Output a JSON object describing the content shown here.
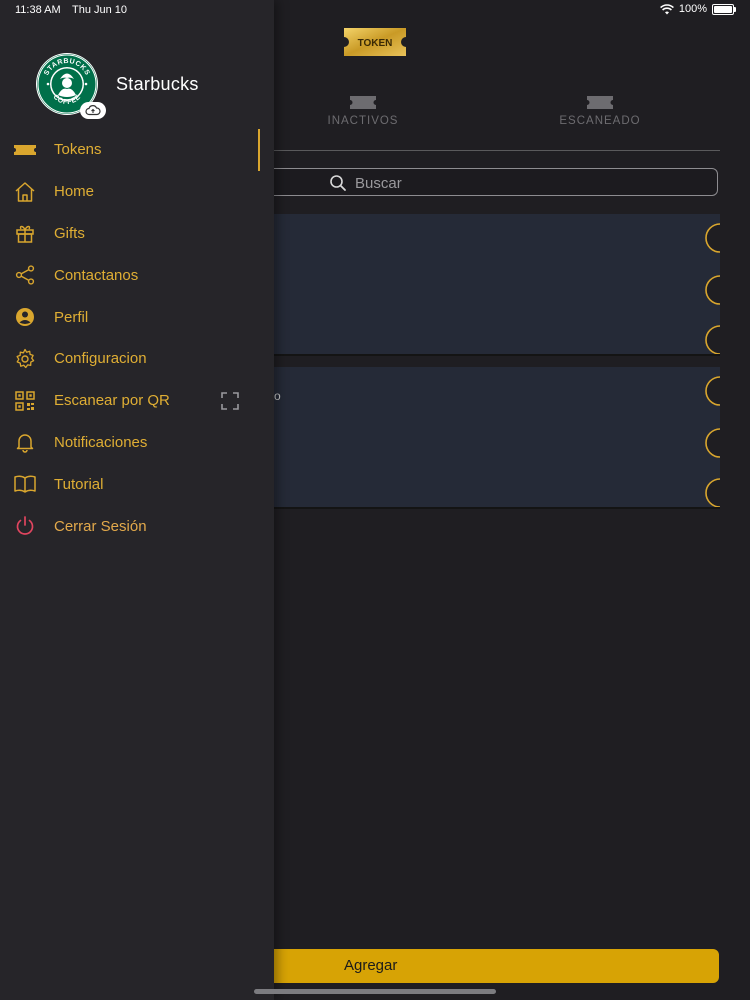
{
  "status_bar": {
    "time": "11:38 AM",
    "date": "Thu Jun 10",
    "battery": "100%"
  },
  "header": {
    "logo_text": "TOKEN"
  },
  "tabs": [
    {
      "label": "INACTIVOS"
    },
    {
      "label": "ESCANEADO"
    }
  ],
  "search": {
    "placeholder": "Buscar"
  },
  "cards": [
    {
      "fragment": ""
    },
    {
      "fragment": "o"
    }
  ],
  "add_button": {
    "label": "Agregar"
  },
  "drawer": {
    "brand_name": "Starbucks",
    "logo_text": "STARBUCKS COFFEE",
    "menu": [
      {
        "label": "Tokens",
        "icon": "ticket-icon"
      },
      {
        "label": "Home",
        "icon": "home-icon"
      },
      {
        "label": "Gifts",
        "icon": "gift-icon"
      },
      {
        "label": "Contactanos",
        "icon": "share-icon"
      },
      {
        "label": "Perfil",
        "icon": "user-circle-icon"
      },
      {
        "label": "Configuracion",
        "icon": "gear-icon"
      },
      {
        "label": "Escanear por QR",
        "icon": "qr-code-icon"
      },
      {
        "label": "Notificaciones",
        "icon": "bell-icon"
      },
      {
        "label": "Tutorial",
        "icon": "book-icon"
      },
      {
        "label": "Cerrar Sesión",
        "icon": "power-icon"
      }
    ]
  },
  "colors": {
    "accent": "#D9A62E",
    "button": "#D7A305",
    "logout": "#E0455F",
    "drawer_bg": "#262529",
    "card_bg": "#252A37"
  }
}
